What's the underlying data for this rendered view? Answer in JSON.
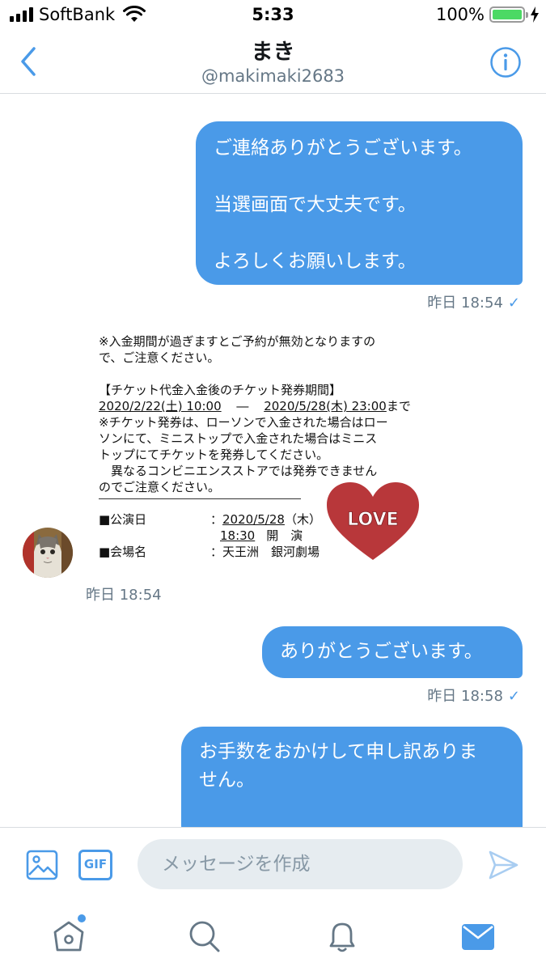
{
  "status_bar": {
    "carrier": "SoftBank",
    "time": "5:33",
    "battery": "100%",
    "battery_level": 1.0
  },
  "header": {
    "title": "まき",
    "handle": "@makimaki2683"
  },
  "messages": [
    {
      "direction": "outgoing",
      "lines": [
        "ご連絡ありがとうございます。",
        "当選画面で大丈夫です。",
        "よろしくお願いします。"
      ],
      "timestamp": "昨日 18:54",
      "status": "✓"
    },
    {
      "direction": "incoming",
      "type": "image",
      "image_text": {
        "line1": "※入金期間が過ぎますとご予約が無効となりますの",
        "line2": "で、ご注意ください。",
        "heading": "【チケット代金入金後のチケット発券期間】",
        "period_start": "2020/2/22(土) 10:00",
        "period_dash": "―",
        "period_end": "2020/5/28(木) 23:00",
        "period_suffix": "まで",
        "note1": "※チケット発券は、ローソンで入金された場合はロー",
        "note2": "ソンにて、ミニストップで入金された場合はミニス",
        "note3": "トップにてチケットを発券してください。",
        "note4": "　異なるコンビニエンスストアでは発券できません",
        "note5": "のでご注意ください。",
        "perf_label": "■公演日",
        "perf_date": "2020/5/28",
        "perf_day": "（木）",
        "perf_time": "18:30",
        "perf_suffix": "開　演",
        "venue_label": "■会場名",
        "venue_value": "：天王洲　銀河劇場",
        "heart_text": "LOVE"
      },
      "timestamp": "昨日 18:54"
    },
    {
      "direction": "outgoing",
      "lines": [
        "ありがとうございます。"
      ],
      "timestamp": "昨日 18:58",
      "status": "✓"
    },
    {
      "direction": "outgoing",
      "lines": [
        "お手数をおかけして申し訳ありま",
        "せん。"
      ]
    }
  ],
  "composer": {
    "placeholder": "メッセージを作成",
    "gif_label": "GIF"
  },
  "tab_bar": {
    "items": [
      "home-icon",
      "search-icon",
      "bell-icon",
      "mail-icon"
    ],
    "active": "mail-icon",
    "home_badge": true
  },
  "colors": {
    "accent": "#4a9ae8",
    "bubble": "#4a9ae8",
    "secondary_text": "#657786",
    "heart": "#b8373a"
  }
}
